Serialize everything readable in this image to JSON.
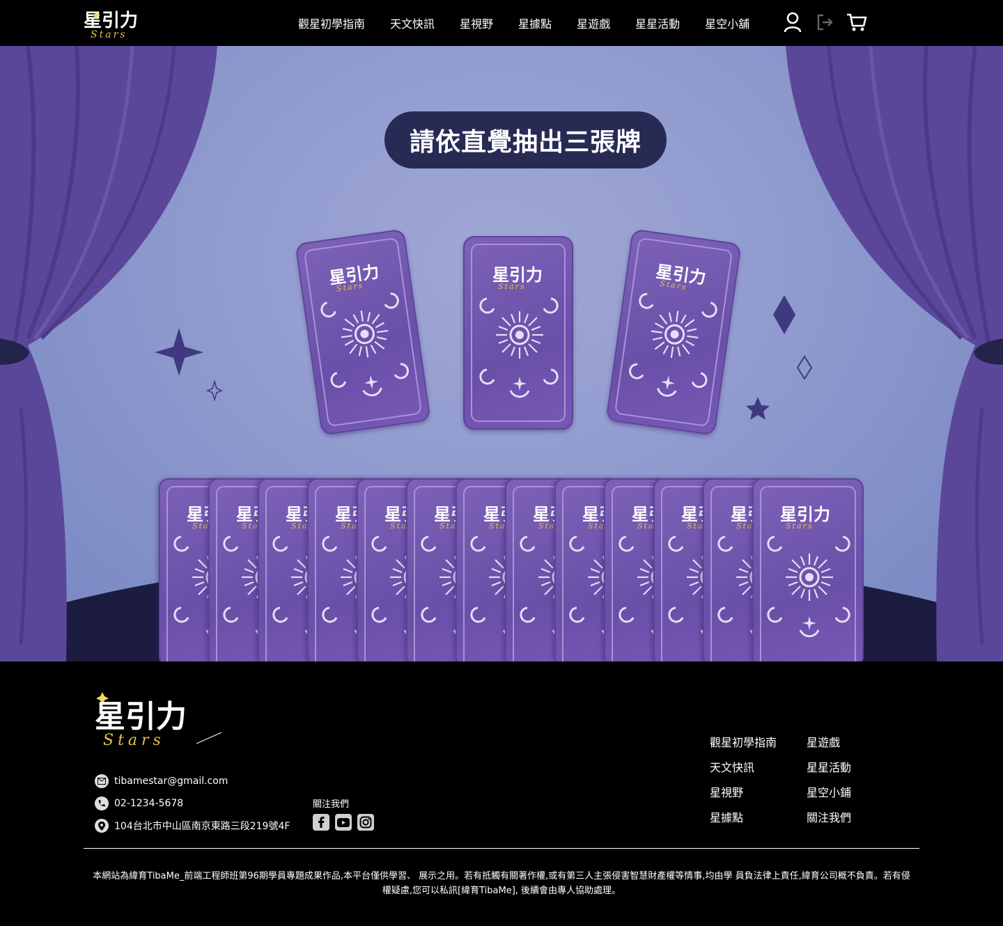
{
  "brand": {
    "name_cn": "星引力",
    "name_en": "Stars"
  },
  "nav": {
    "links": [
      "觀星初學指南",
      "天文快訊",
      "星視野",
      "星據點",
      "星遊戲",
      "星星活動",
      "星空小舖"
    ]
  },
  "hero": {
    "prompt": "請依直覺抽出三張牌",
    "selected_card_count": 3,
    "deck_card_count": 13
  },
  "colors": {
    "card_purple": "#6a4fa8",
    "curtain_purple": "#5b479a",
    "pill_navy": "#272b54",
    "stage_navy": "#1c1c40"
  },
  "footer": {
    "contact": {
      "email": "tibamestar@gmail.com",
      "phone": "02-1234-5678",
      "address": "104台北市中山區南京東路三段219號4F"
    },
    "follow_title": "關注我們",
    "social_icons": [
      "facebook-icon",
      "youtube-icon",
      "instagram-icon"
    ],
    "links": [
      "觀星初學指南",
      "星遊戲",
      "天文快訊",
      "星星活動",
      "星視野",
      "星空小鋪",
      "星據點",
      "關注我們"
    ],
    "copyright": "本網站為緯育TibaMe_前端工程師班第96期學員專題成果作品,本平台僅供學習、 展示之用。若有抵觸有關著作權,或有第三人主張侵害智慧財產權等情事,均由學 員負法律上責任,緯育公司概不負責。若有侵權疑慮,您可以私訊[緯育TibaMe], 後續會由專人協助處理。"
  }
}
